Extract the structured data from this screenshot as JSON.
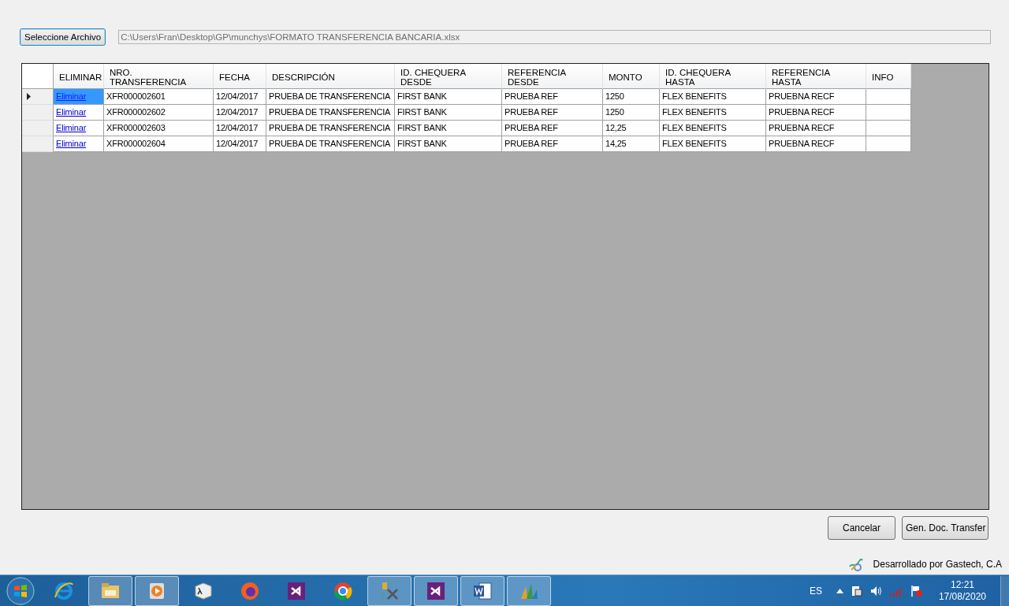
{
  "file_select": {
    "button": "Seleccione Archivo",
    "path": "C:\\Users\\Fran\\Desktop\\GP\\munchys\\FORMATO TRANSFERENCIA BANCARIA.xlsx"
  },
  "table": {
    "columns": [
      "ELIMINAR",
      "NRO.\nTRANSFERENCIA",
      "FECHA",
      "DESCRIPCIÓN",
      "ID. CHEQUERA\nDESDE",
      "REFERENCIA\nDESDE",
      "MONTO",
      "ID. CHEQUERA\nHASTA",
      "REFERENCIA\nHASTA",
      "INFO"
    ],
    "rows": [
      {
        "selected": true,
        "cells": [
          "Eliminar",
          "XFR000002601",
          "12/04/2017",
          "PRUEBA DE TRANSFERENCIA",
          "FIRST BANK",
          "PRUEBA REF",
          "1250",
          "FLEX BENEFITS",
          "PRUEBNA RECF"
        ]
      },
      {
        "selected": false,
        "cells": [
          "Eliminar",
          "XFR000002602",
          "12/04/2017",
          "PRUEBA DE TRANSFERENCIA",
          "FIRST BANK",
          "PRUEBA REF",
          "1250",
          "FLEX BENEFITS",
          "PRUEBNA RECF"
        ]
      },
      {
        "selected": false,
        "cells": [
          "Eliminar",
          "XFR000002603",
          "12/04/2017",
          "PRUEBA DE TRANSFERENCIA",
          "FIRST BANK",
          "PRUEBA REF",
          "12,25",
          "FLEX BENEFITS",
          "PRUEBNA RECF"
        ]
      },
      {
        "selected": false,
        "cells": [
          "Eliminar",
          "XFR000002604",
          "12/04/2017",
          "PRUEBA DE TRANSFERENCIA",
          "FIRST BANK",
          "PRUEBA REF",
          "14,25",
          "FLEX BENEFITS",
          "PRUEBNA RECF"
        ]
      }
    ]
  },
  "buttons": [
    "Cancelar",
    "Gen. Doc. Transfer"
  ],
  "credit": "Desarrollado por Gastech, C.A",
  "taskbar": {
    "items": [
      {
        "kind": "ie",
        "running": false
      },
      {
        "kind": "folder",
        "running": true
      },
      {
        "kind": "media",
        "running": true
      },
      {
        "kind": "lambda",
        "running": false
      },
      {
        "kind": "firefox",
        "running": false
      },
      {
        "kind": "vs",
        "running": false
      },
      {
        "kind": "chrome",
        "running": false
      },
      {
        "kind": "tools",
        "running": true
      },
      {
        "kind": "vs",
        "running": true
      },
      {
        "kind": "word",
        "running": true
      },
      {
        "kind": "chart",
        "running": true
      }
    ],
    "language": "ES",
    "time": "12:21",
    "date": "17/08/2020"
  }
}
